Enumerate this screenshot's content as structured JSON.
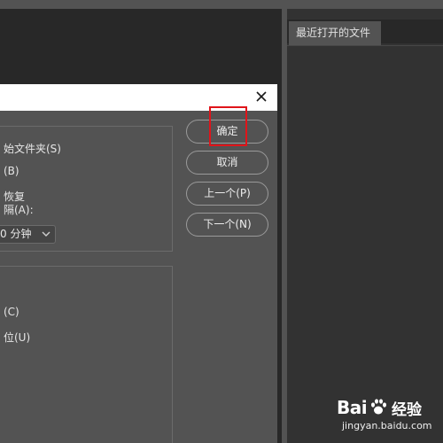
{
  "right_panel": {
    "tab_label": "最近打开的文件"
  },
  "dialog": {
    "group1": {
      "line1": "始文件夹(S)",
      "line2": "(B)",
      "line3": "恢复",
      "line4": "隔(A):",
      "interval_select": {
        "value": "0 分钟"
      }
    },
    "group2": {
      "line1": "(C)",
      "line2": "位(U)"
    },
    "buttons": {
      "ok": "确定",
      "cancel": "取消",
      "prev": "上一个(P)",
      "next": "下一个(N)"
    }
  },
  "watermark": {
    "logo": "Bai",
    "brand": "经验",
    "url": "jingyan.baidu.com"
  },
  "colors": {
    "highlight": "#e0141a",
    "dialog_bg": "#535353",
    "workspace_bg": "#282828"
  },
  "icons": {
    "close": "close-icon",
    "dropdown": "chevron-down-icon",
    "paw": "paw-icon"
  }
}
